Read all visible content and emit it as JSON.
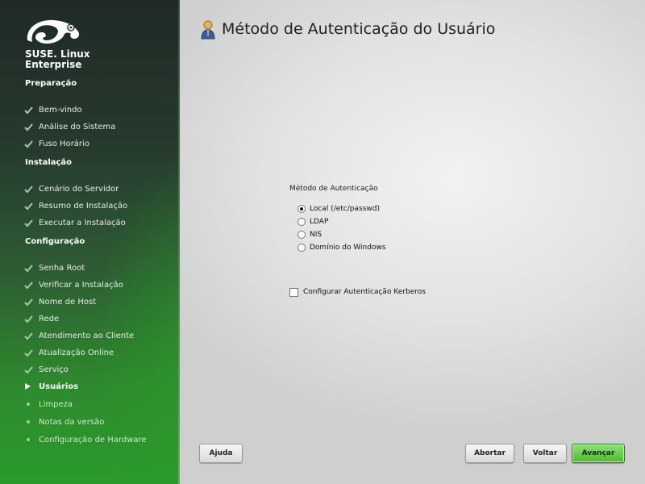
{
  "sidebar": {
    "brand_line1": "SUSE. Linux",
    "brand_line2": "Enterprise",
    "sections": [
      {
        "title": "Preparação",
        "steps": [
          "Bem-vindo",
          "Análise do Sistema",
          "Fuso Horário"
        ]
      },
      {
        "title": "Instalação",
        "steps": [
          "Cenário do Servidor",
          "Resumo de Instalação",
          "Executar a Instalação"
        ]
      },
      {
        "title": "Configuração",
        "steps": [
          "Senha Root",
          "Verificar a Instalação",
          "Nome de Host",
          "Rede",
          "Atendimento ao Cliente",
          "Atualização Online",
          "Serviço",
          "Usuários",
          "Limpeza",
          "Notas da versão",
          "Configuração de Hardware"
        ]
      }
    ],
    "current_step": "Usuários"
  },
  "main": {
    "title": "Método de Autenticação do Usuário",
    "auth_group_label": "Método de Autenticação",
    "options": [
      "Local (/etc/passwd)",
      "LDAP",
      "NIS",
      "Domínio do Windows"
    ],
    "selected_option": "Local (/etc/passwd)",
    "kerberos_label": "Configurar Autenticação Kerberos",
    "kerberos_checked": false
  },
  "buttons": {
    "help": "Ajuda",
    "abort": "Abortar",
    "back": "Voltar",
    "next": "Avançar"
  },
  "colors": {
    "sidebar_green": "#2b9a2b",
    "next_button": "#4cbb2c"
  }
}
